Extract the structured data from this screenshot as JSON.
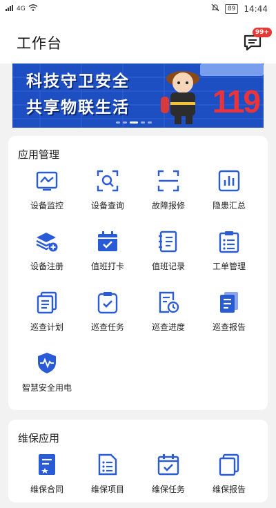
{
  "status": {
    "network": "4G",
    "battery": "89",
    "time": "14:44"
  },
  "header": {
    "title": "工作台",
    "badge": "99+"
  },
  "banner": {
    "line1": "科技守卫安全",
    "line2": "共享物联生活",
    "number": "119"
  },
  "sections": [
    {
      "title": "应用管理",
      "items": [
        {
          "label": "设备监控",
          "icon": "monitor-icon"
        },
        {
          "label": "设备查询",
          "icon": "scan-search-icon"
        },
        {
          "label": "故障报修",
          "icon": "scan-frame-icon"
        },
        {
          "label": "隐患汇总",
          "icon": "bar-chart-icon"
        },
        {
          "label": "设备注册",
          "icon": "layers-add-icon"
        },
        {
          "label": "值班打卡",
          "icon": "calendar-check-icon"
        },
        {
          "label": "值班记录",
          "icon": "notebook-icon"
        },
        {
          "label": "工单管理",
          "icon": "clipboard-list-icon"
        },
        {
          "label": "巡查计划",
          "icon": "documents-icon"
        },
        {
          "label": "巡查任务",
          "icon": "clipboard-check-icon"
        },
        {
          "label": "巡查进度",
          "icon": "document-clock-icon"
        },
        {
          "label": "巡查报告",
          "icon": "report-icon"
        },
        {
          "label": "智慧安全用电",
          "icon": "shield-pulse-icon"
        }
      ]
    },
    {
      "title": "维保应用",
      "items": [
        {
          "label": "维保合同",
          "icon": "contract-icon"
        },
        {
          "label": "维保项目",
          "icon": "list-doc-icon"
        },
        {
          "label": "维保任务",
          "icon": "calendar-check-icon"
        },
        {
          "label": "维保报告",
          "icon": "documents-icon"
        }
      ]
    }
  ],
  "colors": {
    "accent": "#2a5bd7",
    "badge": "#e53935",
    "banner": "#1e4fc2"
  }
}
